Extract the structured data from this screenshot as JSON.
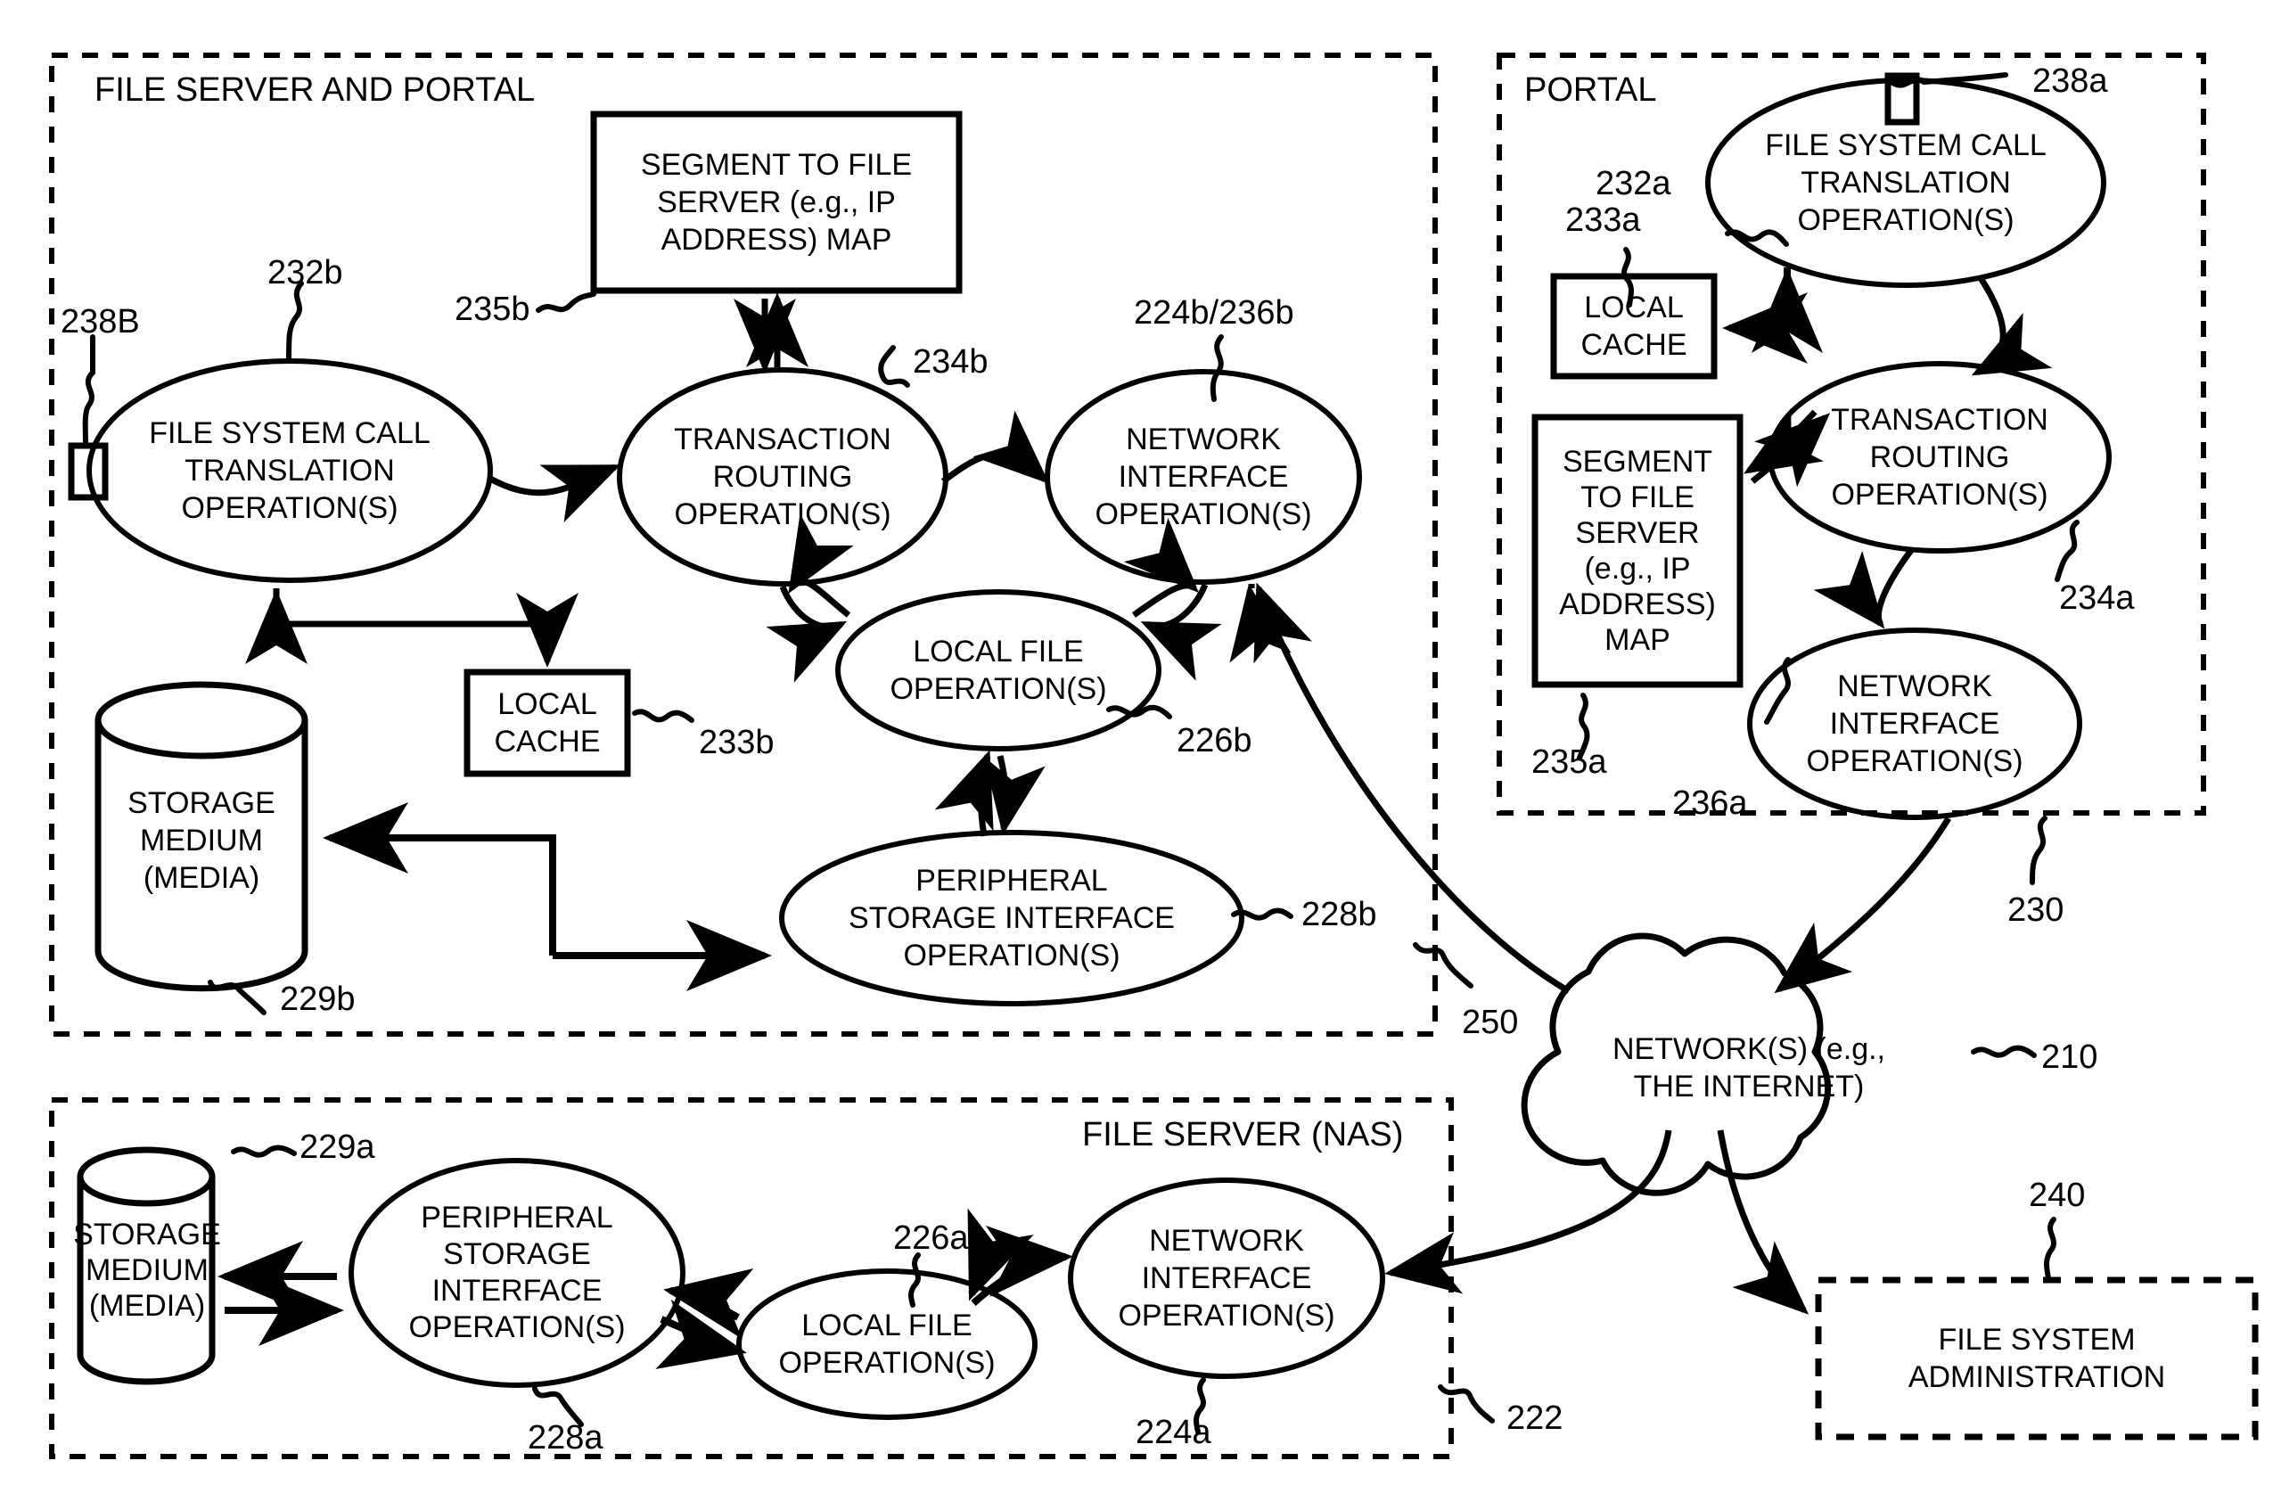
{
  "figure": {
    "groups": [
      {
        "id": "file-server-and-portal",
        "title": "FILE SERVER AND PORTAL",
        "ref": "250"
      },
      {
        "id": "portal",
        "title": "PORTAL",
        "ref": "230"
      },
      {
        "id": "file-server-nas",
        "title": "FILE SERVER (NAS)",
        "ref": "222"
      }
    ],
    "nodes": {
      "fscall_b": {
        "label": [
          "FILE SYSTEM CALL",
          "TRANSLATION",
          "OPERATION(S)"
        ],
        "ref": "232b",
        "shape": "ellipse"
      },
      "segmap_b": {
        "label": [
          "SEGMENT TO FILE",
          "SERVER (e.g., IP",
          "ADDRESS) MAP"
        ],
        "ref": "235b",
        "shape": "rect"
      },
      "txrout_b": {
        "label": [
          "TRANSACTION",
          "ROUTING",
          "OPERATION(S)"
        ],
        "ref": "234b",
        "shape": "ellipse"
      },
      "netif_b": {
        "label": [
          "NETWORK",
          "INTERFACE",
          "OPERATION(S)"
        ],
        "ref": "224b/236b",
        "shape": "ellipse"
      },
      "localfile_b": {
        "label": [
          "LOCAL FILE",
          "OPERATION(S)"
        ],
        "ref": "226b",
        "shape": "ellipse"
      },
      "cache_b": {
        "label": [
          "LOCAL",
          "CACHE"
        ],
        "ref": "233b",
        "shape": "rect"
      },
      "storage_b": {
        "label": [
          "STORAGE",
          "MEDIUM",
          "(MEDIA)"
        ],
        "ref": "229b",
        "shape": "cylinder"
      },
      "periph_b": {
        "label": [
          "PERIPHERAL",
          "STORAGE INTERFACE",
          "OPERATION(S)"
        ],
        "ref": "228b",
        "shape": "ellipse"
      },
      "port_b": {
        "ref": "238B",
        "shape": "port"
      },
      "fscall_a": {
        "label": [
          "FILE SYSTEM CALL",
          "TRANSLATION",
          "OPERATION(S)"
        ],
        "ref": "232a",
        "shape": "ellipse"
      },
      "cache_a": {
        "label": [
          "LOCAL",
          "CACHE"
        ],
        "ref": "233a",
        "shape": "rect"
      },
      "segmap_a": {
        "label": [
          "SEGMENT",
          "TO FILE",
          "SERVER",
          "(e.g., IP",
          "ADDRESS)",
          "MAP"
        ],
        "ref": "235a",
        "shape": "rect"
      },
      "txrout_a": {
        "label": [
          "TRANSACTION",
          "ROUTING",
          "OPERATION(S)"
        ],
        "ref": "234a",
        "shape": "ellipse"
      },
      "netif_a": {
        "label": [
          "NETWORK",
          "INTERFACE",
          "OPERATION(S)"
        ],
        "ref": "236a",
        "shape": "ellipse"
      },
      "port_a": {
        "ref": "238a",
        "shape": "port"
      },
      "storage_a": {
        "label": [
          "STORAGE",
          "MEDIUM",
          "(MEDIA)"
        ],
        "ref": "229a",
        "shape": "cylinder"
      },
      "periph_a": {
        "label": [
          "PERIPHERAL",
          "STORAGE",
          "INTERFACE",
          "OPERATION(S)"
        ],
        "ref": "228a",
        "shape": "ellipse"
      },
      "localfile_a": {
        "label": [
          "LOCAL FILE",
          "OPERATION(S)"
        ],
        "ref": "226a",
        "shape": "ellipse"
      },
      "netif_nas": {
        "label": [
          "NETWORK",
          "INTERFACE",
          "OPERATION(S)"
        ],
        "ref": "224a",
        "shape": "ellipse"
      },
      "network": {
        "label": [
          "NETWORK(S) (e.g.,",
          "THE INTERNET)"
        ],
        "ref": "210",
        "shape": "cloud"
      },
      "fsadmin": {
        "label": [
          "FILE SYSTEM",
          "ADMINISTRATION"
        ],
        "ref": "240",
        "shape": "dashed-rect"
      }
    },
    "reference_numerals": [
      "235b",
      "232b",
      "238B",
      "234b",
      "224b/236b",
      "233b",
      "229b",
      "226b",
      "228b",
      "238a",
      "232a",
      "233a",
      "235a",
      "234a",
      "236a",
      "230",
      "250",
      "210",
      "240",
      "222",
      "229a",
      "228a",
      "226a",
      "224a"
    ]
  }
}
